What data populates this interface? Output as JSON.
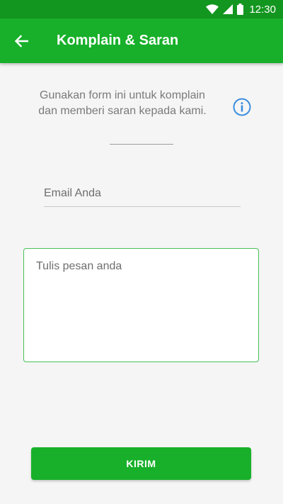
{
  "status_bar": {
    "time": "12:30",
    "icons": [
      "wifi-icon",
      "cellular-signal-icon",
      "battery-icon"
    ]
  },
  "app_bar": {
    "back_icon": "arrow-left-icon",
    "title": "Komplain & Saran"
  },
  "form": {
    "description_line1": "Gunakan form ini untuk komplain",
    "description_line2": "dan memberi saran kepada kami.",
    "info_icon": "info-icon",
    "email_placeholder": "Email Anda",
    "email_value": "",
    "message_placeholder": "Tulis pesan anda",
    "message_value": "",
    "submit_label": "KIRIM"
  },
  "colors": {
    "status_bar": "#13961f",
    "app_bar": "#18b02a",
    "accent": "#46c157",
    "info_icon": "#3b8ee0",
    "background": "#f5f5f5"
  }
}
